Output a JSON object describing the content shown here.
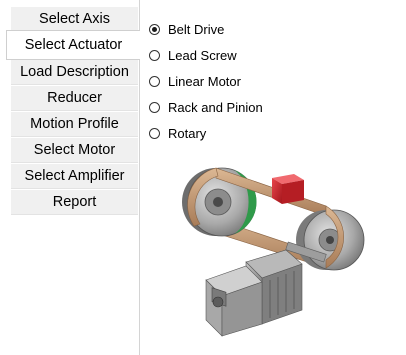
{
  "tabs": [
    {
      "label": "Select Axis",
      "selected": false
    },
    {
      "label": "Select Actuator",
      "selected": true
    },
    {
      "label": "Load Description",
      "selected": false
    },
    {
      "label": "Reducer",
      "selected": false
    },
    {
      "label": "Motion Profile",
      "selected": false
    },
    {
      "label": "Select Motor",
      "selected": false
    },
    {
      "label": "Select Amplifier",
      "selected": false
    },
    {
      "label": "Report",
      "selected": false
    }
  ],
  "actuator_options": [
    {
      "label": "Belt Drive",
      "checked": true
    },
    {
      "label": "Lead Screw",
      "checked": false
    },
    {
      "label": "Linear Motor",
      "checked": false
    },
    {
      "label": "Rack and Pinion",
      "checked": false
    },
    {
      "label": "Rotary",
      "checked": false
    }
  ],
  "illustration": {
    "icon": "belt-drive-illustration",
    "colors": {
      "belt": "#c9a27c",
      "pulley_green": "#2f9a4a",
      "pulley_gray": "#9a9a9a",
      "load_block": "#d8262e",
      "motor": "#8e8e8e"
    }
  }
}
